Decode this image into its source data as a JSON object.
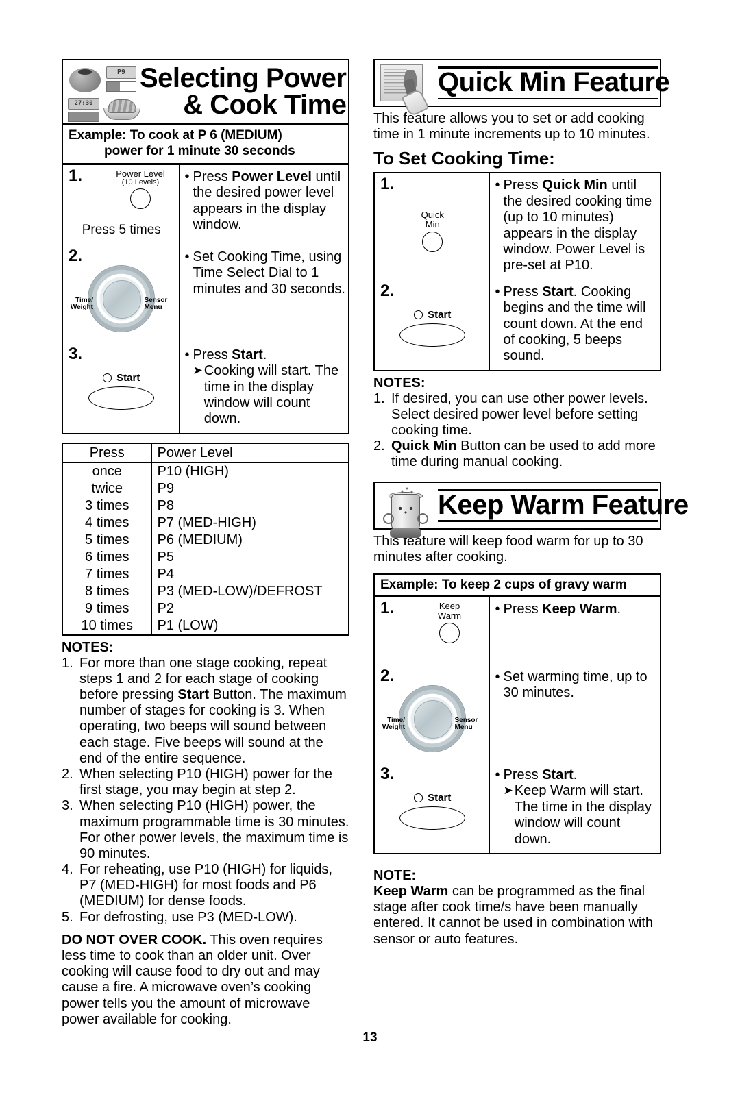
{
  "page": {
    "number": "13"
  },
  "left": {
    "banner": {
      "line1": "Selecting Power",
      "line2": "& Cook Time",
      "display_p": "P9",
      "display_time": "27:30"
    },
    "example": {
      "line1": "Example: To cook at P 6 (MEDIUM)",
      "line2": "power for 1 minute 30 seconds"
    },
    "steps": [
      {
        "num": "1.",
        "control_label_line1": "Power Level",
        "control_label_line2": "(10 Levels)",
        "press_times": "Press 5 times",
        "bullet": "•",
        "text_pre": "Press ",
        "text_bold": "Power Level",
        "text_post": " until the desired power level appears in the display window."
      },
      {
        "num": "2.",
        "dial_left": "Time/ Weight",
        "dial_left_l1": "Time/",
        "dial_left_l2": "Weight",
        "dial_right_l1": "Sensor",
        "dial_right_l2": "Menu",
        "bullet": "•",
        "text": "Set Cooking Time, using Time Select Dial to 1 minutes and 30 seconds."
      },
      {
        "num": "3.",
        "start_label": "Start",
        "bullet": "•",
        "text_pre": "Press ",
        "text_bold": "Start",
        "text_post": ".",
        "arrow": "➤",
        "arrow_text": "Cooking will start. The time in the display window will count down."
      }
    ],
    "power_table": {
      "header_press": "Press",
      "header_level": "Power Level",
      "rows": [
        {
          "press": "once",
          "level": "P10 (HIGH)"
        },
        {
          "press": "twice",
          "level": "P9"
        },
        {
          "press": "3 times",
          "level": "P8"
        },
        {
          "press": "4 times",
          "level": "P7 (MED-HIGH)"
        },
        {
          "press": "5 times",
          "level": "P6 (MEDIUM)"
        },
        {
          "press": "6 times",
          "level": "P5"
        },
        {
          "press": "7 times",
          "level": "P4"
        },
        {
          "press": "8 times",
          "level": "P3 (MED-LOW)/DEFROST"
        },
        {
          "press": "9 times",
          "level": "P2"
        },
        {
          "press": "10 times",
          "level": "P1 (LOW)"
        }
      ]
    },
    "notes_heading": "NOTES:",
    "notes": [
      {
        "num": "1.",
        "pre": "For more than one stage cooking, repeat steps 1 and 2 for each stage of cooking before pressing ",
        "bold": "Start",
        "post": " Button. The maximum number of stages for cooking is 3. When operating, two beeps will sound between each stage. Five beeps will sound at the end of the entire sequence."
      },
      {
        "num": "2.",
        "pre": "When selecting P10 (HIGH) power for the first stage, you may begin at step 2.",
        "bold": "",
        "post": ""
      },
      {
        "num": "3.",
        "pre": "When selecting P10 (HIGH) power, the maximum programmable time is 30 minutes. For other power levels, the maximum time is 90 minutes.",
        "bold": "",
        "post": ""
      },
      {
        "num": "4.",
        "pre": "For reheating, use P10 (HIGH) for liquids, P7 (MED-HIGH) for most foods and P6 (MEDIUM) for dense foods.",
        "bold": "",
        "post": ""
      },
      {
        "num": "5.",
        "pre": "For defrosting, use P3 (MED-LOW).",
        "bold": "",
        "post": ""
      }
    ],
    "warning": {
      "bold": "DO NOT OVER COOK.",
      "text": " This oven requires less time to cook than an older unit. Over cooking will cause food to dry out and may cause a fire. A microwave oven’s cooking power tells you the amount of microwave power available for cooking."
    }
  },
  "right": {
    "quick_min": {
      "banner_title": "Quick Min Feature",
      "intro": "This feature allows you to set or add cooking time in 1 minute increments up to 10 minutes.",
      "subheading": "To Set Cooking Time:",
      "steps": [
        {
          "num": "1.",
          "control_l1": "Quick",
          "control_l2": "Min",
          "bullet": "•",
          "text_pre": "Press ",
          "text_bold": "Quick Min",
          "text_post": " until the desired cooking time (up to 10 minutes) appears in the display window. Power Level is pre-set at P10."
        },
        {
          "num": "2.",
          "start_label": "Start",
          "bullet": "•",
          "text_pre": "Press ",
          "text_bold": "Start",
          "text_post": ". Cooking begins and the time will count down. At the end of cooking, 5 beeps sound."
        }
      ],
      "notes_heading": "NOTES:",
      "notes": [
        {
          "num": "1.",
          "pre": "If desired, you can use other power levels. Select desired power level before setting cooking time.",
          "bold": "",
          "post": ""
        },
        {
          "num": "2.",
          "pre": "",
          "bold": "Quick Min",
          "post": " Button can be used to add more time during manual cooking."
        }
      ]
    },
    "keep_warm": {
      "banner_title": "Keep Warm Feature",
      "intro": "This feature will keep food warm for up to 30 minutes after cooking.",
      "example": "Example: To keep 2 cups of gravy warm",
      "steps": [
        {
          "num": "1.",
          "control_l1": "Keep",
          "control_l2": "Warm",
          "bullet": "•",
          "text_pre": "Press ",
          "text_bold": "Keep Warm",
          "text_post": "."
        },
        {
          "num": "2.",
          "dial_left_l1": "Time/",
          "dial_left_l2": "Weight",
          "dial_right_l1": "Sensor",
          "dial_right_l2": "Menu",
          "bullet": "•",
          "text": "Set warming time, up to 30 minutes."
        },
        {
          "num": "3.",
          "start_label": "Start",
          "bullet": "•",
          "text_pre": "Press ",
          "text_bold": "Start",
          "text_post": ".",
          "arrow": "➤",
          "arrow_text": "Keep Warm will start. The time in the display window will count down."
        }
      ],
      "note_heading": "NOTE:",
      "note_bold": "Keep Warm",
      "note_text": " can be programmed as the final stage after cook time/s have been manually entered. It cannot be used in combination with sensor or auto features."
    }
  }
}
